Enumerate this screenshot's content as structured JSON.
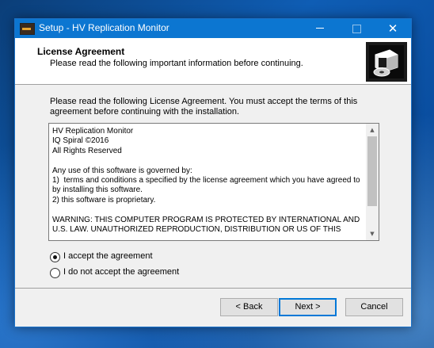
{
  "window": {
    "title": "Setup - HV Replication Monitor"
  },
  "header": {
    "title": "License Agreement",
    "subtitle": "Please read the following important information before continuing."
  },
  "intro_text": "Please read the following License Agreement. You must accept the terms of this agreement before continuing with the installation.",
  "license_text": "HV Replication Monitor\nIQ Spiral ©2016\nAll Rights Reserved\n\nAny use of this software is governed by:\n1)  terms and conditions a specified by the license agreement which you have agreed to by installing this software.\n2) this software is proprietary.\n\nWARNING: THIS COMPUTER PROGRAM IS PROTECTED BY INTERNATIONAL AND U.S. LAW. UNAUTHORIZED REPRODUCTION, DISTRIBUTION OR US OF THIS",
  "options": {
    "accept_label": "I accept the agreement",
    "decline_label": "I do not accept the agreement",
    "selected": "accept"
  },
  "buttons": {
    "back_label": "< Back",
    "next_label": "Next >",
    "cancel_label": "Cancel"
  },
  "icons": {
    "app": "installer-app-icon",
    "header_logo": "setup-computer-icon",
    "minimize": "minimize-icon",
    "maximize": "maximize-icon",
    "close": "close-icon"
  },
  "colors": {
    "titlebar": "#0c76d1",
    "window_bg": "#f0f0f0",
    "default_button_border": "#0078d7"
  }
}
